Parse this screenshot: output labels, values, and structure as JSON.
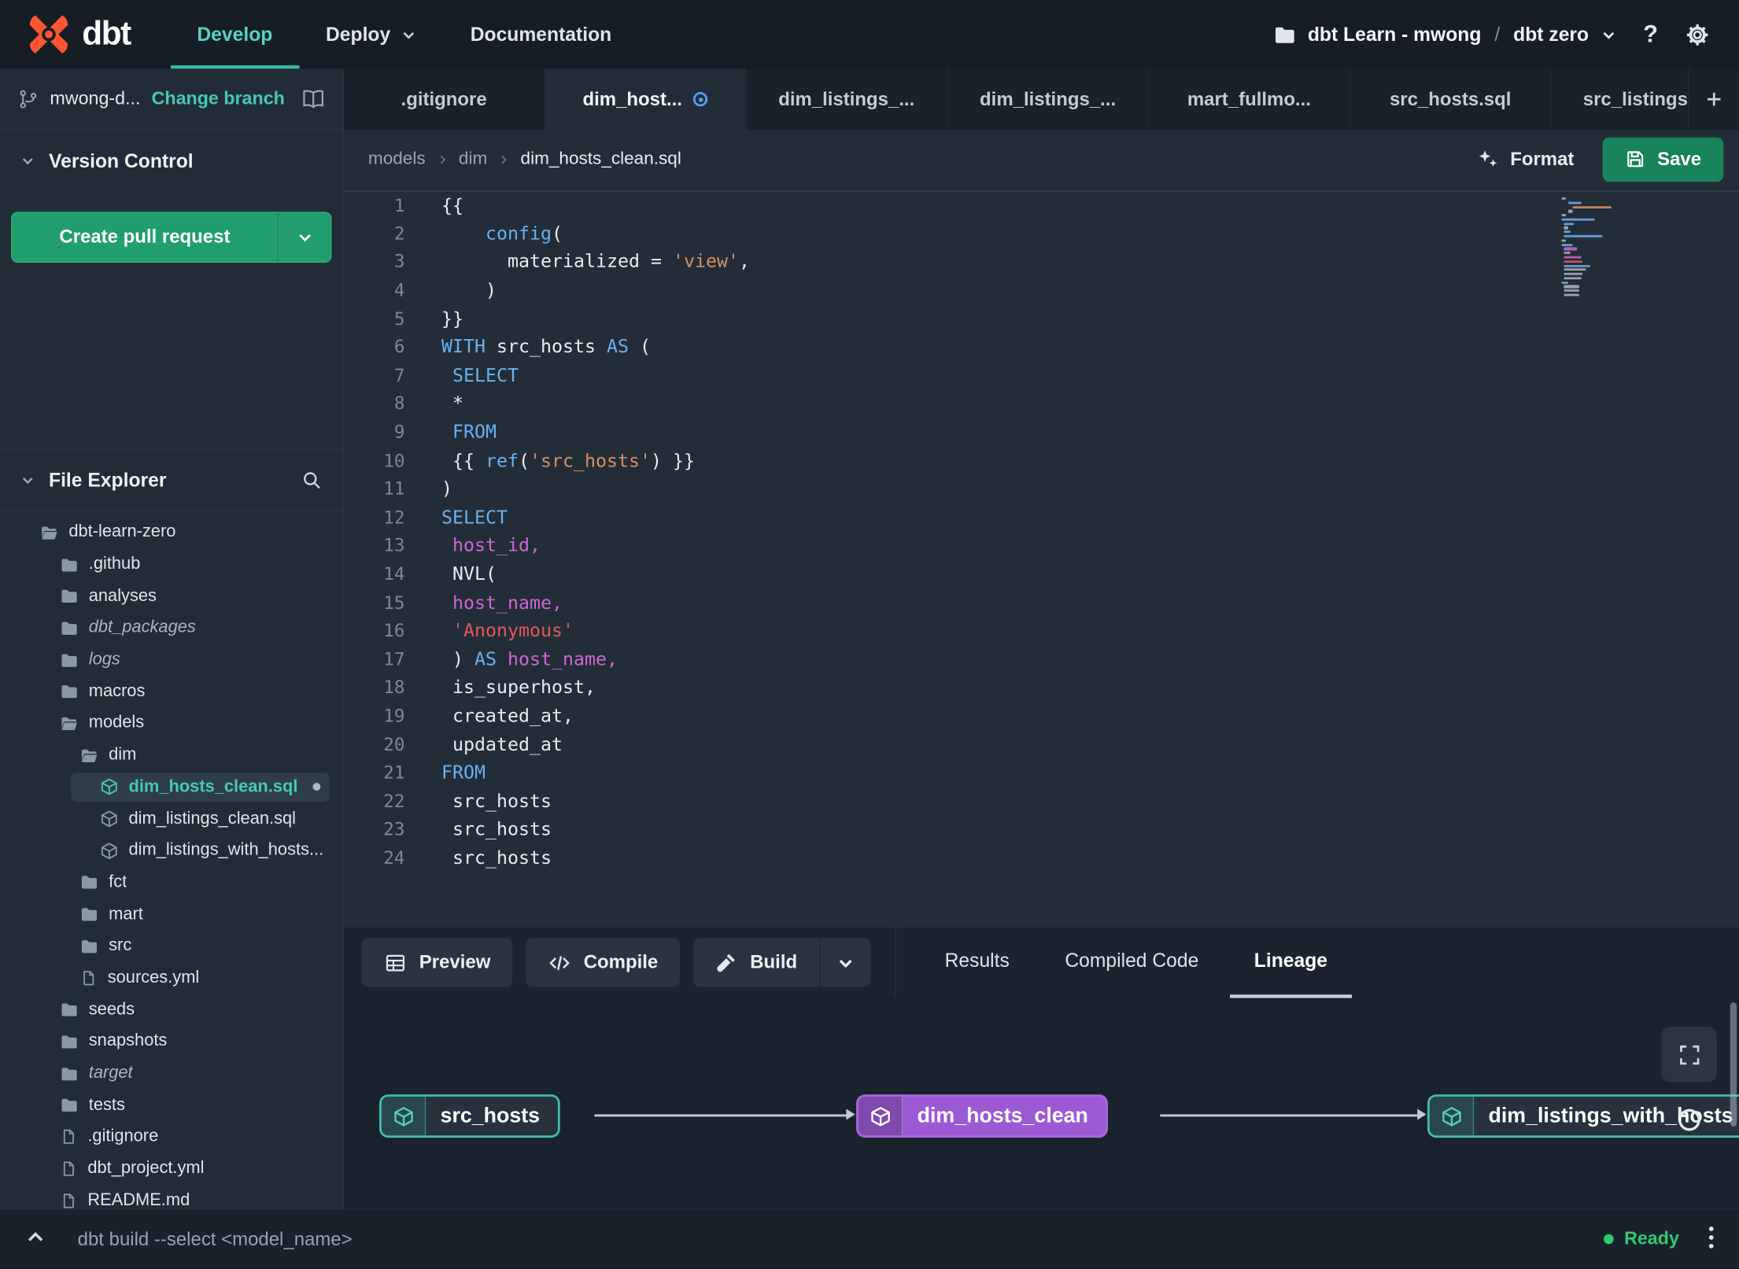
{
  "navbar": {
    "logo_text": "dbt",
    "items": [
      {
        "label": "Develop",
        "active": true
      },
      {
        "label": "Deploy",
        "caret": true
      },
      {
        "label": "Documentation"
      }
    ],
    "account_label": "dbt Learn - mwong",
    "separator": "/",
    "project_label": "dbt zero",
    "help_label": "?"
  },
  "sidebar": {
    "branch": {
      "name": "mwong-d...",
      "change_action": "Change branch"
    },
    "version_control": {
      "title": "Version Control",
      "create_pr_label": "Create pull request"
    },
    "file_explorer": {
      "title": "File Explorer",
      "tree": [
        {
          "label": "dbt-learn-zero",
          "icon": "folder-open",
          "level": 0
        },
        {
          "label": ".github",
          "icon": "folder",
          "level": 1
        },
        {
          "label": "analyses",
          "icon": "folder",
          "level": 1
        },
        {
          "label": "dbt_packages",
          "icon": "folder",
          "level": 1,
          "italic": true
        },
        {
          "label": "logs",
          "icon": "folder",
          "level": 1,
          "italic": true
        },
        {
          "label": "macros",
          "icon": "folder",
          "level": 1
        },
        {
          "label": "models",
          "icon": "folder-open",
          "level": 1
        },
        {
          "label": "dim",
          "icon": "folder-open",
          "level": 2
        },
        {
          "label": "dim_hosts_clean.sql",
          "icon": "model",
          "level": 3,
          "selected": true,
          "modified": true
        },
        {
          "label": "dim_listings_clean.sql",
          "icon": "model",
          "level": 3
        },
        {
          "label": "dim_listings_with_hosts...",
          "icon": "model",
          "level": 3
        },
        {
          "label": "fct",
          "icon": "folder",
          "level": 2
        },
        {
          "label": "mart",
          "icon": "folder",
          "level": 2
        },
        {
          "label": "src",
          "icon": "folder",
          "level": 2
        },
        {
          "label": "sources.yml",
          "icon": "file",
          "level": 2
        },
        {
          "label": "seeds",
          "icon": "folder",
          "level": 1
        },
        {
          "label": "snapshots",
          "icon": "folder",
          "level": 1
        },
        {
          "label": "target",
          "icon": "folder",
          "level": 1,
          "italic": true
        },
        {
          "label": "tests",
          "icon": "folder",
          "level": 1
        },
        {
          "label": ".gitignore",
          "icon": "file",
          "level": 1
        },
        {
          "label": "dbt_project.yml",
          "icon": "file",
          "level": 1
        },
        {
          "label": "README.md",
          "icon": "file",
          "level": 1
        }
      ]
    }
  },
  "editor_tabs": [
    {
      "label": ".gitignore"
    },
    {
      "label": "dim_host...",
      "active": true,
      "modified": true
    },
    {
      "label": "dim_listings_..."
    },
    {
      "label": "dim_listings_..."
    },
    {
      "label": "mart_fullmo..."
    },
    {
      "label": "src_hosts.sql"
    },
    {
      "label": "src_listings.sql"
    }
  ],
  "breadcrumb": [
    "models",
    "dim",
    "dim_hosts_clean.sql"
  ],
  "editor_actions": {
    "format_label": "Format",
    "save_label": "Save"
  },
  "editor": {
    "language": "sql",
    "lines": [
      {
        "parts": [
          {
            "t": "{{",
            "c": "p"
          }
        ]
      },
      {
        "parts": [
          {
            "t": "    ",
            "c": "p"
          },
          {
            "t": "config",
            "c": "fn"
          },
          {
            "t": "(",
            "c": "p"
          }
        ]
      },
      {
        "parts": [
          {
            "t": "      materialized = ",
            "c": "p"
          },
          {
            "t": "'view'",
            "c": "str"
          },
          {
            "t": ",",
            "c": "p"
          }
        ]
      },
      {
        "parts": [
          {
            "t": "    )",
            "c": "p"
          }
        ]
      },
      {
        "parts": [
          {
            "t": "}}",
            "c": "p"
          }
        ]
      },
      {
        "parts": [
          {
            "t": "WITH",
            "c": "kw"
          },
          {
            "t": " src_hosts ",
            "c": "p"
          },
          {
            "t": "AS",
            "c": "kw"
          },
          {
            "t": " (",
            "c": "p"
          }
        ]
      },
      {
        "parts": [
          {
            "t": " ",
            "c": "p"
          },
          {
            "t": "SELECT",
            "c": "kw"
          }
        ]
      },
      {
        "parts": [
          {
            "t": " *",
            "c": "p"
          }
        ]
      },
      {
        "parts": [
          {
            "t": " ",
            "c": "p"
          },
          {
            "t": "FROM",
            "c": "kw"
          }
        ]
      },
      {
        "parts": [
          {
            "t": " {{ ",
            "c": "p"
          },
          {
            "t": "ref",
            "c": "fn"
          },
          {
            "t": "(",
            "c": "p"
          },
          {
            "t": "'src_hosts'",
            "c": "str"
          },
          {
            "t": ") }}",
            "c": "p"
          }
        ]
      },
      {
        "parts": [
          {
            "t": ")",
            "c": "p"
          }
        ]
      },
      {
        "parts": [
          {
            "t": "SELECT",
            "c": "kw"
          }
        ]
      },
      {
        "parts": [
          {
            "t": " ",
            "c": "p"
          },
          {
            "t": "host_id,",
            "c": "var"
          }
        ]
      },
      {
        "parts": [
          {
            "t": " NVL(",
            "c": "p"
          }
        ]
      },
      {
        "parts": [
          {
            "t": " ",
            "c": "p"
          },
          {
            "t": "host_name,",
            "c": "var"
          }
        ]
      },
      {
        "parts": [
          {
            "t": " ",
            "c": "p"
          },
          {
            "t": "'Anonymous'",
            "c": "str2"
          }
        ]
      },
      {
        "parts": [
          {
            "t": " ) ",
            "c": "p"
          },
          {
            "t": "AS",
            "c": "kw"
          },
          {
            "t": " ",
            "c": "p"
          },
          {
            "t": "host_name,",
            "c": "var"
          }
        ]
      },
      {
        "parts": [
          {
            "t": " is_superhost,",
            "c": "p"
          }
        ]
      },
      {
        "parts": [
          {
            "t": " created_at,",
            "c": "p"
          }
        ]
      },
      {
        "parts": [
          {
            "t": " updated_at",
            "c": "p"
          }
        ]
      },
      {
        "parts": [
          {
            "t": "FROM",
            "c": "kw"
          }
        ]
      },
      {
        "parts": [
          {
            "t": " src_hosts",
            "c": "p"
          }
        ]
      },
      {
        "parts": [
          {
            "t": " src_hosts",
            "c": "p"
          }
        ]
      },
      {
        "parts": [
          {
            "t": " src_hosts",
            "c": "p"
          }
        ]
      }
    ]
  },
  "bottom_panel": {
    "preview_label": "Preview",
    "compile_label": "Compile",
    "build_label": "Build",
    "tabs": [
      {
        "label": "Results"
      },
      {
        "label": "Compiled Code"
      },
      {
        "label": "Lineage",
        "active": true
      }
    ]
  },
  "lineage": {
    "nodes": [
      {
        "label": "src_hosts",
        "style": "source"
      },
      {
        "label": "dim_hosts_clean",
        "style": "selected-model"
      },
      {
        "label": "dim_listings_with_hosts",
        "style": "source"
      }
    ]
  },
  "statusbar": {
    "command": "dbt build --select <model_name>",
    "status_label": "Ready"
  },
  "colors": {
    "accent_teal": "#3ec1b1",
    "green_button": "#219e6d",
    "save_green": "#17835a",
    "purple_node": "#9c59d4",
    "logo_orange": "#ff5632",
    "modified_blue": "#539bf5",
    "ready_green": "#2fcb72"
  }
}
